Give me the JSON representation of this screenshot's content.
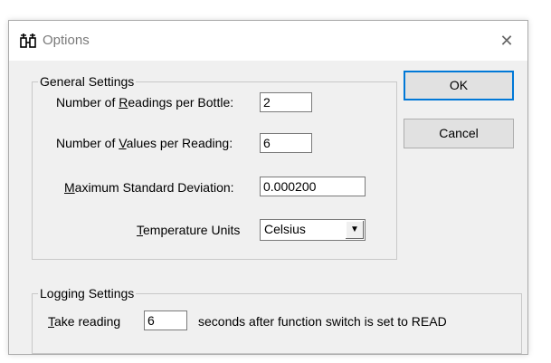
{
  "window": {
    "title": "Options",
    "close_glyph": "✕",
    "icon": "app-icon"
  },
  "general": {
    "legend": "General Settings",
    "readings_label_pre": "Number of ",
    "readings_label_ul": "R",
    "readings_label_post": "eadings per Bottle:",
    "readings_value": "2",
    "values_label_pre": "Number of ",
    "values_label_ul": "V",
    "values_label_post": "alues per Reading:",
    "values_value": "6",
    "stddev_label_ul": "M",
    "stddev_label_post": "aximum Standard Deviation:",
    "stddev_value": "0.000200",
    "temp_label_ul": "T",
    "temp_label_post": "emperature Units",
    "temp_value": "Celsius",
    "dropdown_glyph": "▼"
  },
  "logging": {
    "legend": "Logging Settings",
    "take_label_ul": "T",
    "take_label_post": "ake reading",
    "take_value": "6",
    "suffix": "seconds after function switch is set to READ"
  },
  "buttons": {
    "ok": "OK",
    "cancel": "Cancel"
  }
}
